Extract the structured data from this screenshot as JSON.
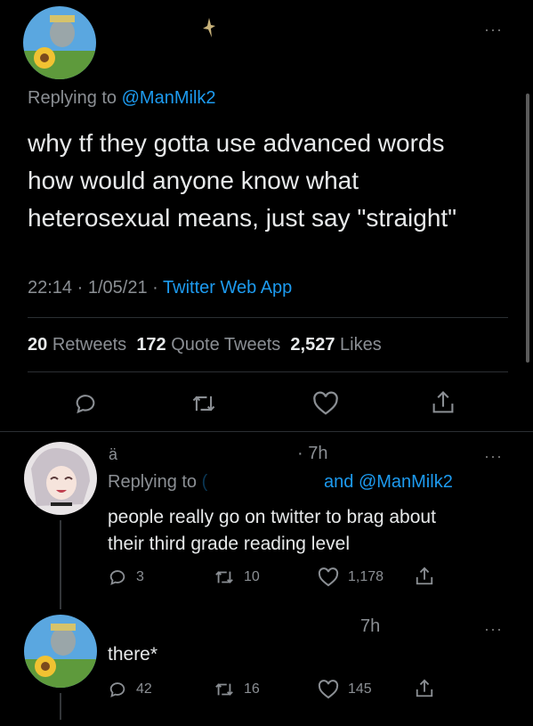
{
  "main_tweet": {
    "replying_prefix": "Replying to",
    "replying_handle": "@ManMilk2",
    "text_line1": "why tf they gotta use advanced words",
    "text_line2": "how would anyone know what",
    "text_line3": "heterosexual means, just say \"straight\"",
    "time": "22:14",
    "date": "1/05/21",
    "sep": "·",
    "source": "Twitter Web App",
    "more": "···",
    "stats": {
      "retweets_count": "20",
      "retweets_label": "Retweets",
      "quotes_count": "172",
      "quotes_label": "Quote Tweets",
      "likes_count": "2,527",
      "likes_label": "Likes"
    }
  },
  "reply1": {
    "time_ago": "· 7h",
    "replying_prefix": "Replying to",
    "replying_mid": "and",
    "replying_handle": "@ManMilk2",
    "text_line1": "people really go on twitter to brag about",
    "text_line2": "their third grade reading level",
    "replies": "3",
    "retweets": "10",
    "likes": "1,178",
    "more": "···"
  },
  "reply2": {
    "time_ago": "7h",
    "text": "there*",
    "replies": "42",
    "retweets": "16",
    "likes": "145",
    "more": "···"
  },
  "icons": {
    "reply": "reply-icon",
    "retweet": "retweet-icon",
    "like": "like-icon",
    "share": "share-icon"
  },
  "colors": {
    "accent": "#1d9bf0",
    "background": "#000000",
    "text": "#e7e9ea",
    "muted": "#8b8f94"
  }
}
